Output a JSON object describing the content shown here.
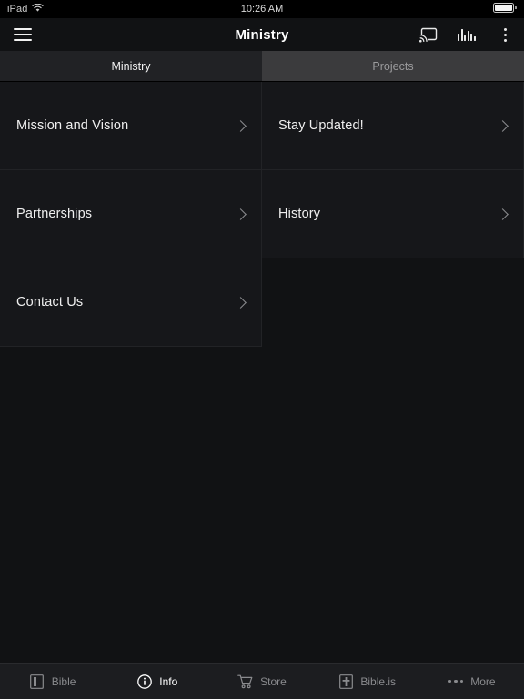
{
  "status_bar": {
    "device": "iPad",
    "wifi_icon": "wifi-icon",
    "clock": "10:26 AM",
    "battery_icon": "battery-full-icon"
  },
  "nav_bar": {
    "menu_icon": "hamburger-menu-icon",
    "title": "Ministry",
    "cast_icon": "chromecast-icon",
    "equalizer_icon": "audio-equalizer-icon",
    "overflow_icon": "kebab-menu-icon"
  },
  "segmented_tabs": {
    "selected": "Ministry",
    "items": [
      {
        "label": "Ministry",
        "active": true
      },
      {
        "label": "Projects",
        "active": false
      }
    ]
  },
  "grid": {
    "chevron_icon": "chevron-right-icon",
    "cells": [
      {
        "label": "Mission and Vision",
        "empty": false
      },
      {
        "label": "Stay Updated!",
        "empty": false
      },
      {
        "label": "Partnerships",
        "empty": false
      },
      {
        "label": "History",
        "empty": false
      },
      {
        "label": "Contact Us",
        "empty": false
      },
      {
        "label": "",
        "empty": true
      }
    ]
  },
  "tab_bar": {
    "items": [
      {
        "label": "Bible",
        "icon": "book-icon",
        "active": false
      },
      {
        "label": "Info",
        "icon": "info-circle-icon",
        "active": true
      },
      {
        "label": "Store",
        "icon": "shopping-cart-icon",
        "active": false
      },
      {
        "label": "Bible.is",
        "icon": "bible-cross-icon",
        "active": false
      },
      {
        "label": "More",
        "icon": "more-dots-icon",
        "active": false
      }
    ]
  },
  "colors": {
    "background": "#111214",
    "cell_background": "#16171a",
    "tab_active_background": "#212225",
    "tab_inactive_background": "#3b3b3d",
    "tabbar_background": "#1c1d20",
    "text_primary": "#efefef",
    "text_muted": "#8a8b8e"
  }
}
